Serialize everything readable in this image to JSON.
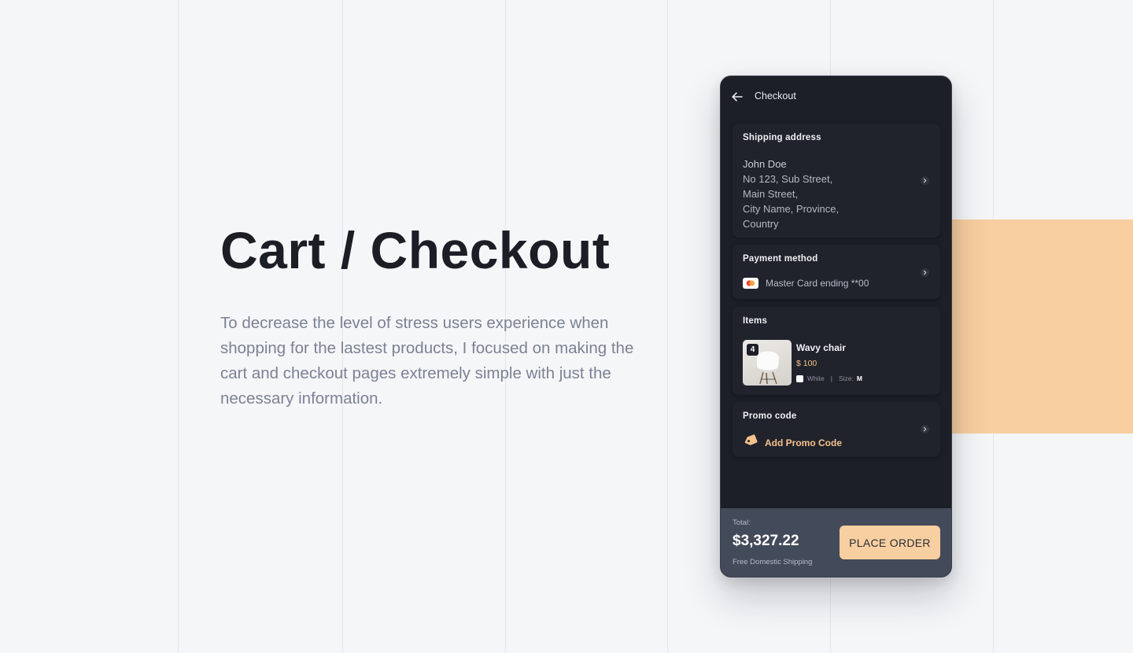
{
  "colors": {
    "page_bg": "#f5f6f8",
    "accent": "#f8cfa0",
    "phone_bg": "#1c1f27",
    "card_bg": "#20232b",
    "footer_bg": "#434a59",
    "highlight_text": "#f6c28d",
    "button_bg": "#f8cfa0"
  },
  "hero": {
    "title": "Cart / Checkout",
    "description": "To decrease the level of stress users experience when shopping for the lastest products, I focused on making the cart and checkout pages extremely simple with just the necessary information."
  },
  "phone": {
    "header": {
      "back_icon": "arrow-left-icon",
      "title": "Checkout"
    },
    "shipping": {
      "title": "Shipping address",
      "name": "John Doe",
      "lines": [
        "No 123, Sub Street,",
        "Main Street,",
        "City Name, Province,",
        "Country"
      ]
    },
    "payment": {
      "title": "Payment method",
      "card_icon": "mastercard-icon",
      "label": "Master Card ending **00"
    },
    "items": {
      "title": "Items",
      "list": [
        {
          "quantity": "4",
          "name": "Wavy chair",
          "price": "$ 100",
          "color": "White",
          "separator": "|",
          "size_label": "Size:",
          "size": "M"
        }
      ]
    },
    "promo": {
      "title": "Promo code",
      "icon": "tag-icon",
      "label": "Add Promo Code"
    },
    "footer": {
      "total_label": "Total:",
      "total_amount": "$3,327.22",
      "shipping_note": "Free Domestic Shipping",
      "button_label": "PLACE ORDER"
    }
  }
}
